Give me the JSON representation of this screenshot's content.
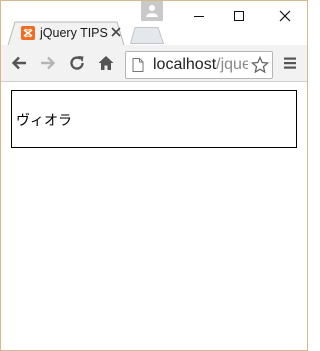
{
  "window": {
    "frame_color": "#d7b88d",
    "controls": {
      "minimize": "minimize-icon",
      "maximize": "maximize-icon",
      "close": "close-icon"
    }
  },
  "tab": {
    "title": "jQuery TIPS",
    "favicon": "xampp-favicon-icon",
    "favicon_color": "#f26c21"
  },
  "toolbar": {
    "back": "back-arrow-icon",
    "forward": "forward-arrow-icon",
    "reload": "reload-icon",
    "home": "home-icon",
    "menu": "hamburger-menu-icon",
    "bookmark": "star-icon"
  },
  "address": {
    "host": "localhost",
    "path": "/jque"
  },
  "page": {
    "box_text": "ヴィオラ"
  }
}
